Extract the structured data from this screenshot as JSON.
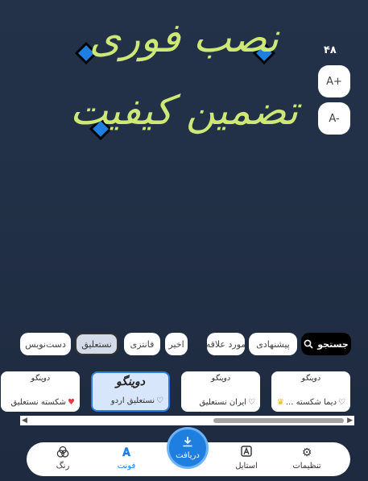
{
  "canvas": {
    "line1": "نصب فوری",
    "line2": "تضمین کیفیت",
    "text_color": "#cde876",
    "diamond_color": "#1e7fe0"
  },
  "font_size": {
    "value": "۴۸",
    "increase_label": "A+",
    "decrease_label": "A-"
  },
  "categories": {
    "search_label": "جستجو",
    "items": [
      "پیشنهادی",
      "مورد علاقه",
      "اخیر",
      "فانتزی",
      "نستعلیق",
      "دست‌نویس"
    ],
    "active": "نستعلیق"
  },
  "fonts": [
    {
      "preview": "دوینگو",
      "label": "دیما شکسته ...",
      "favorite": false,
      "premium": true
    },
    {
      "preview": "دوینگو",
      "label": "ایران نستعلیق",
      "favorite": false,
      "premium": false
    },
    {
      "preview": "دوینگو",
      "label": "نستعلیق اردو",
      "favorite": false,
      "premium": false,
      "selected": true
    },
    {
      "preview": "دوینگو",
      "label": "شکسته نستعلیق",
      "favorite": true,
      "premium": false
    }
  ],
  "nav": {
    "settings": "تنظیمات",
    "style": "استایل",
    "download": "دریافت",
    "font": "فونت",
    "color": "رنگ",
    "active": "فونت",
    "accent_color": "#1e7fe0"
  }
}
